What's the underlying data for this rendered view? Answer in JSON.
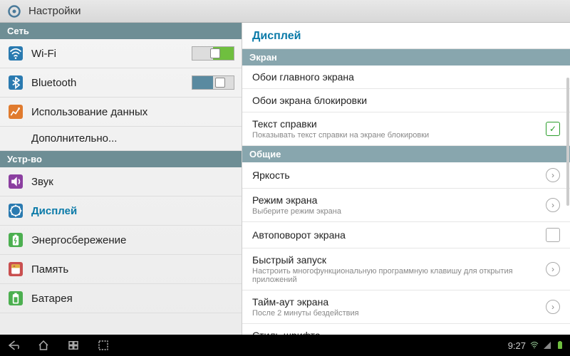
{
  "titlebar": {
    "title": "Настройки"
  },
  "sidebar": {
    "sections": [
      {
        "header": "Сеть",
        "items": [
          {
            "label": "Wi-Fi",
            "icon": "wifi",
            "toggle": "on"
          },
          {
            "label": "Bluetooth",
            "icon": "bluetooth",
            "toggle": "off"
          },
          {
            "label": "Использование данных",
            "icon": "data"
          },
          {
            "label": "Дополнительно...",
            "icon": ""
          }
        ]
      },
      {
        "header": "Устр-во",
        "items": [
          {
            "label": "Звук",
            "icon": "sound"
          },
          {
            "label": "Дисплей",
            "icon": "display",
            "selected": true
          },
          {
            "label": "Энергосбережение",
            "icon": "power"
          },
          {
            "label": "Память",
            "icon": "storage"
          },
          {
            "label": "Батарея",
            "icon": "battery"
          }
        ]
      }
    ]
  },
  "detail": {
    "title": "Дисплей",
    "sections": [
      {
        "header": "Экран",
        "items": [
          {
            "main": "Обои главного экрана"
          },
          {
            "main": "Обои экрана блокировки"
          },
          {
            "main": "Текст справки",
            "sub": "Показывать текст справки на экране блокировки",
            "checkbox": true,
            "checked": true
          }
        ]
      },
      {
        "header": "Общие",
        "items": [
          {
            "main": "Яркость",
            "chevron": true
          },
          {
            "main": "Режим экрана",
            "sub": "Выберите режим экрана",
            "chevron": true
          },
          {
            "main": "Автоповорот экрана",
            "checkbox": true,
            "checked": false
          },
          {
            "main": "Быстрый запуск",
            "sub": "Настроить многофункциональную программную клавишу для открытия приложений",
            "chevron": true
          },
          {
            "main": "Тайм-аут экрана",
            "sub": "После 2 минуты бездействия",
            "chevron": true
          },
          {
            "main": "Стиль шрифта"
          }
        ]
      }
    ]
  },
  "navbar": {
    "time": "9:27"
  },
  "icon_colors": {
    "wifi": "#2a7ab0",
    "bluetooth": "#2a7ab0",
    "data": "#e07b2e",
    "sound": "#8b3fa0",
    "display": "#2a7ab0",
    "power": "#4caf50",
    "storage": "#c94f4f",
    "battery": "#4caf50"
  }
}
